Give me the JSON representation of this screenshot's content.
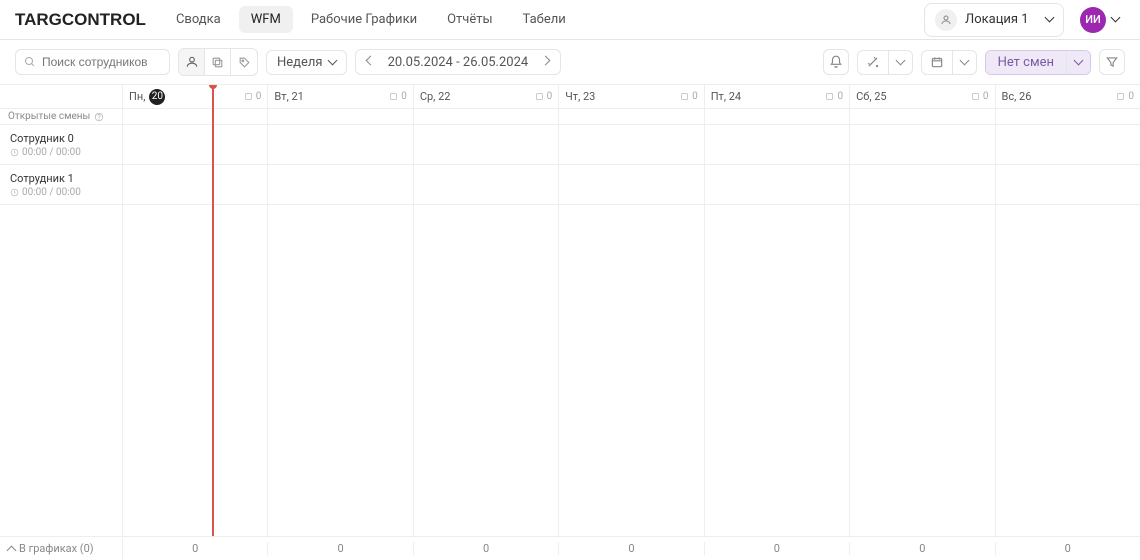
{
  "app": {
    "logo": "TARGCONTROL"
  },
  "nav": {
    "items": [
      {
        "label": "Сводка"
      },
      {
        "label": "WFM"
      },
      {
        "label": "Рабочие Графики"
      },
      {
        "label": "Отчёты"
      },
      {
        "label": "Табели"
      }
    ],
    "active_index": 1
  },
  "topbar": {
    "location": {
      "label": "Локация 1"
    },
    "user": {
      "initials": "ИИ"
    }
  },
  "toolbar": {
    "search_placeholder": "Поиск сотрудников",
    "period_label": "Неделя",
    "date_range": "20.05.2024 - 26.05.2024",
    "shifts_button": "Нет смен"
  },
  "schedule": {
    "days": [
      {
        "label": "Пн,",
        "daynum": "20",
        "is_today": true,
        "count": "0"
      },
      {
        "label": "Вт, 21",
        "daynum": "",
        "is_today": false,
        "count": "0"
      },
      {
        "label": "Ср, 22",
        "daynum": "",
        "is_today": false,
        "count": "0"
      },
      {
        "label": "Чт, 23",
        "daynum": "",
        "is_today": false,
        "count": "0"
      },
      {
        "label": "Пт, 24",
        "daynum": "",
        "is_today": false,
        "count": "0"
      },
      {
        "label": "Сб, 25",
        "daynum": "",
        "is_today": false,
        "count": "0"
      },
      {
        "label": "Вс, 26",
        "daynum": "",
        "is_today": false,
        "count": "0"
      }
    ],
    "open_shifts_label": "Открытые смены",
    "employees": [
      {
        "name": "Сотрудник 0",
        "hours": "00:00 / 00:00"
      },
      {
        "name": "Сотрудник 1",
        "hours": "00:00 / 00:00"
      }
    ]
  },
  "footer": {
    "label": "В графиках (0)",
    "totals": [
      "0",
      "0",
      "0",
      "0",
      "0",
      "0",
      "0"
    ]
  }
}
